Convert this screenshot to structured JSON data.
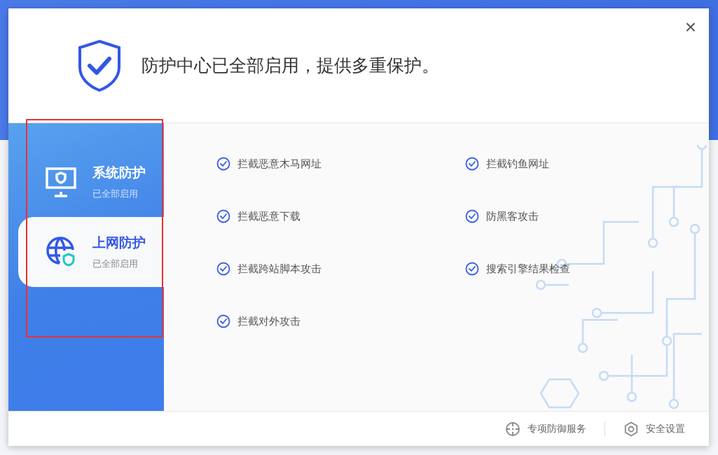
{
  "dialog": {
    "close": "×",
    "headline": "防护中心已全部启用，提供多重保护。"
  },
  "sidebar": {
    "items": [
      {
        "title": "系统防护",
        "status": "已全部启用",
        "kind": "monitor",
        "selected": false
      },
      {
        "title": "上网防护",
        "status": "已全部启用",
        "kind": "globe",
        "selected": true
      }
    ]
  },
  "features": [
    "拦截恶意木马网址",
    "拦截钓鱼网址",
    "拦截恶意下载",
    "防黑客攻击",
    "拦截跨站脚本攻击",
    "搜索引擎结果检查",
    "拦截对外攻击"
  ],
  "footer": {
    "links": [
      {
        "label": "专项防御服务",
        "kind": "target"
      },
      {
        "label": "安全设置",
        "kind": "gear"
      }
    ]
  }
}
